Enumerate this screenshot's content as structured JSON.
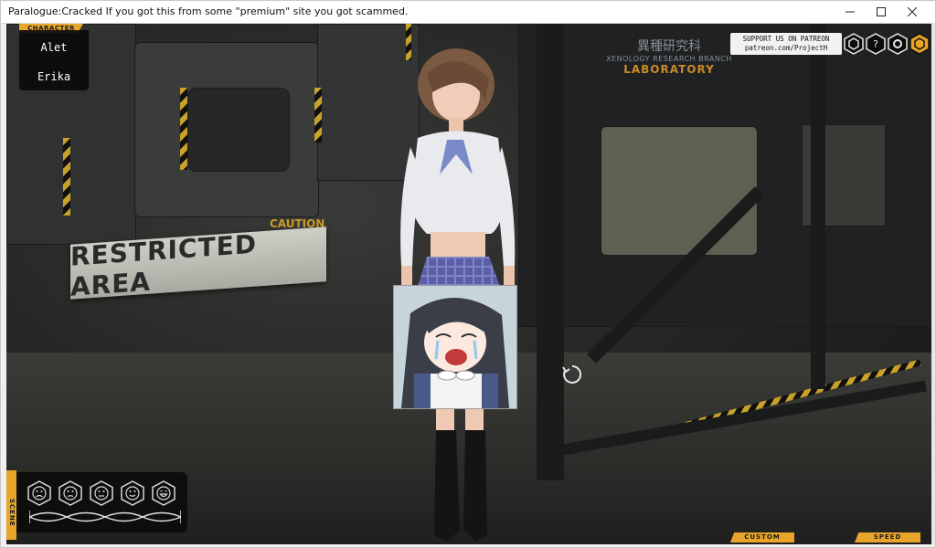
{
  "window": {
    "title": "Paralogue:Cracked If you got this from some \"premium\" site you got scammed.",
    "minimize_icon": "minimize-icon",
    "maximize_icon": "maximize-icon",
    "close_icon": "close-icon"
  },
  "character_panel": {
    "tab_label": "CHARACTER",
    "characters": [
      "Alet",
      "Erika"
    ]
  },
  "patreon": {
    "line1": "SUPPORT US ON PATREON",
    "line2": "patreon.com/ProjectH"
  },
  "top_right_buttons": [
    "settings-hex-icon",
    "help-hex-icon",
    "gear-hex-icon",
    "gear-hex-active-icon"
  ],
  "scene_panel": {
    "tab_label": "SCENE",
    "emotes": [
      "sad-face-icon",
      "frown-face-icon",
      "neutral-face-icon",
      "smile-face-icon",
      "happy-face-icon"
    ]
  },
  "environment": {
    "restricted": "RESTRICTED AREA",
    "caution": "CAUTION",
    "lab_kanji": "異種研究科",
    "lab_branch": "XENOLOGY RESEARCH BRANCH",
    "lab_name": "LABORATORY"
  },
  "bottom_tabs": {
    "custom": "CUSTOM",
    "speed": "SPEED"
  },
  "colors": {
    "accent": "#e8a52a",
    "panel": "#0c0c0c"
  }
}
